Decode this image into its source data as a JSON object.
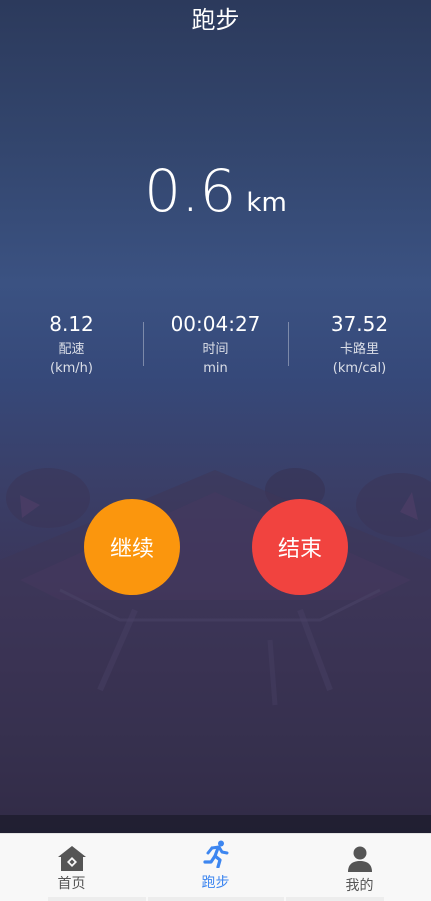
{
  "header": {
    "title": "跑步"
  },
  "distance": {
    "value": "0.6",
    "unit": "km"
  },
  "stats": [
    {
      "value": "8.12",
      "label": "配速",
      "unit": "(km/h)"
    },
    {
      "value": "00:04:27",
      "label": "时间",
      "unit": "min"
    },
    {
      "value": "37.52",
      "label": "卡路里",
      "unit": "(km/cal)"
    }
  ],
  "actions": {
    "continue_label": "继续",
    "stop_label": "结束",
    "continue_color": "#fb960d",
    "stop_color": "#f1433f"
  },
  "tabbar": {
    "active_color": "#3d86f0",
    "items": [
      {
        "label": "首页",
        "icon": "home-icon"
      },
      {
        "label": "跑步",
        "icon": "runner-icon"
      },
      {
        "label": "我的",
        "icon": "person-icon"
      }
    ]
  }
}
